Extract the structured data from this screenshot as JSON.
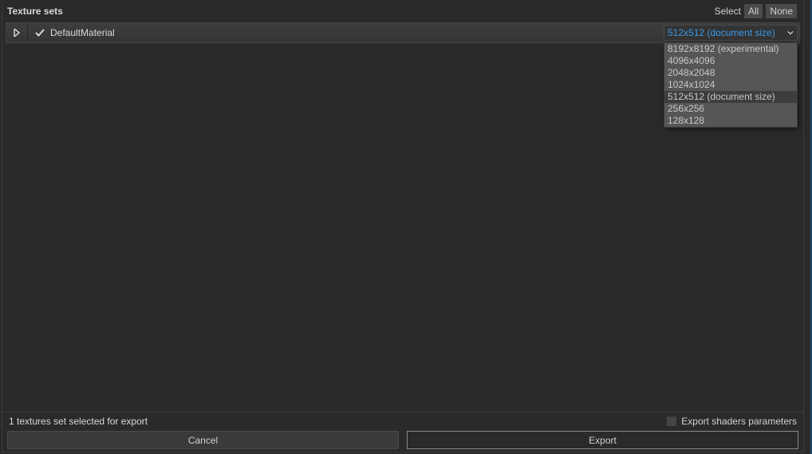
{
  "header": {
    "title": "Texture sets",
    "select_label": "Select",
    "all_button": "All",
    "none_button": "None"
  },
  "texture_set": {
    "checked": true,
    "name": "DefaultMaterial"
  },
  "size_combo": {
    "selected": "512x512 (document size)",
    "options": [
      "8192x8192 (experimental)",
      "4096x4096",
      "2048x2048",
      "1024x1024",
      "512x512 (document size)",
      "256x256",
      "128x128"
    ],
    "highlighted_index": 4
  },
  "footer": {
    "status": "1 textures set selected for export",
    "export_shaders_label": "Export shaders parameters",
    "cancel_label": "Cancel",
    "export_label": "Export"
  }
}
